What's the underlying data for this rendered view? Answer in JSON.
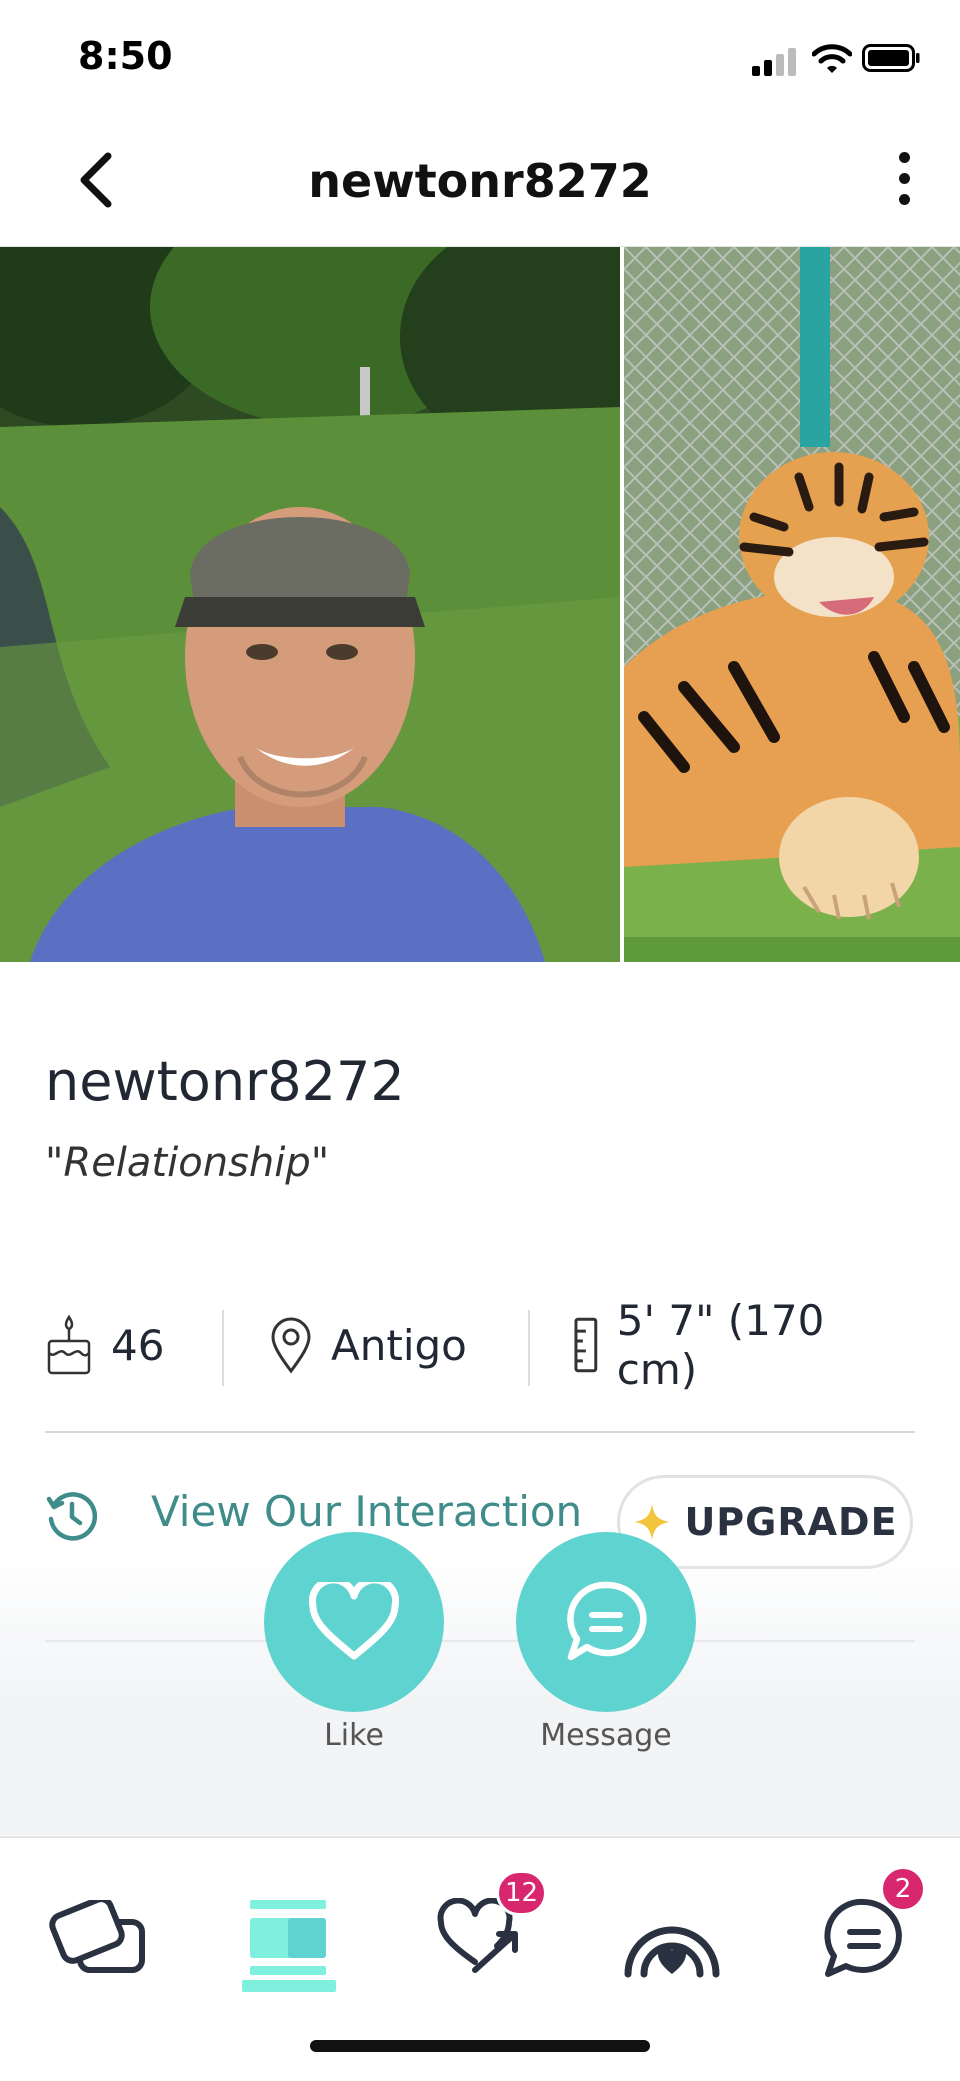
{
  "status_bar": {
    "time": "8:50"
  },
  "header": {
    "title": "newtonr8272"
  },
  "profile": {
    "username": "newtonr8272",
    "intent": "\"Relationship\"",
    "stats": {
      "age": "46",
      "location": "Antigo",
      "height": "5' 7\" (170 cm)"
    }
  },
  "interaction": {
    "link_label": "View Our Interaction",
    "upgrade_label": "UPGRADE"
  },
  "actions": {
    "like_label": "Like",
    "message_label": "Message"
  },
  "tab_bar": {
    "likes_badge": "12",
    "messages_badge": "2",
    "selected_tab": "profiles"
  },
  "colors": {
    "accent": "#5fd3d0",
    "link": "#3f8c8a",
    "badge": "#d8266f",
    "tab_active": "#7ef0dd"
  }
}
